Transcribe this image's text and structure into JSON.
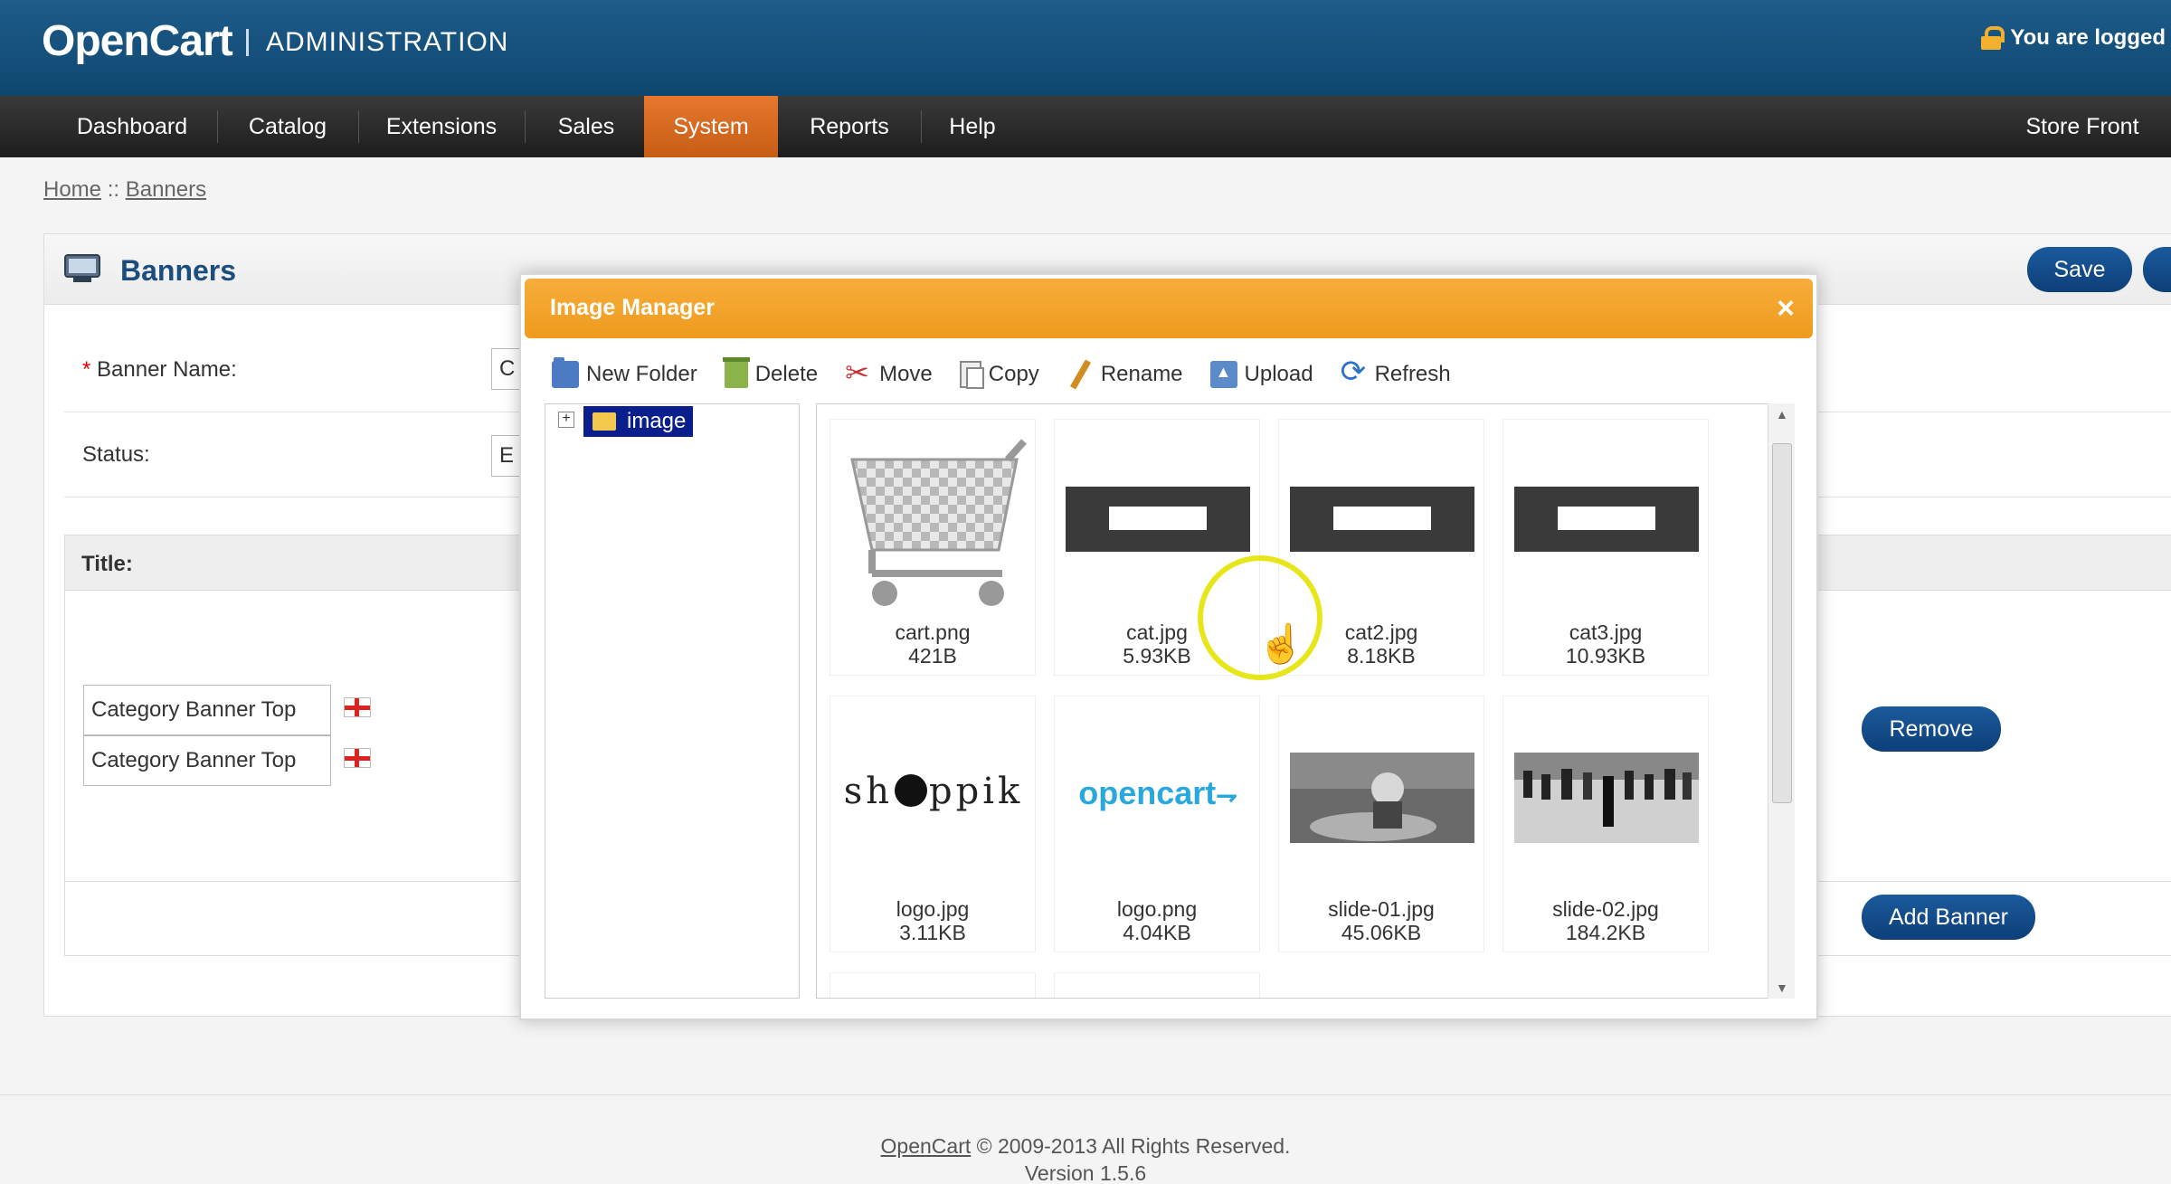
{
  "header": {
    "brand": "OpenCart",
    "section": "ADMINISTRATION",
    "user_status": "You are logged"
  },
  "menu": {
    "items": [
      {
        "label": "Dashboard"
      },
      {
        "label": "Catalog"
      },
      {
        "label": "Extensions"
      },
      {
        "label": "Sales"
      },
      {
        "label": "System",
        "active": true
      },
      {
        "label": "Reports"
      },
      {
        "label": "Help"
      }
    ],
    "store_front": "Store Front"
  },
  "breadcrumb": {
    "home": "Home",
    "separator": "::",
    "current": "Banners"
  },
  "page": {
    "title": "Banners",
    "save_label": "Save",
    "banner_name_label": "Banner Name:",
    "banner_name_value": "C",
    "status_label": "Status:",
    "status_value": "E",
    "title_column": "Title:",
    "title_rows": [
      "Category Banner Top",
      "Category Banner Top"
    ],
    "remove_label": "Remove",
    "add_banner_label": "Add Banner",
    "icon": "banner-screen-icon"
  },
  "image_manager": {
    "title": "Image Manager",
    "close": "×",
    "toolbar": {
      "new_folder": "New Folder",
      "delete": "Delete",
      "move": "Move",
      "copy": "Copy",
      "rename": "Rename",
      "upload": "Upload",
      "refresh": "Refresh"
    },
    "tree": {
      "expand": "+",
      "root": "image"
    },
    "files": [
      {
        "name": "cart.png",
        "size": "421B"
      },
      {
        "name": "cat.jpg",
        "size": "5.93KB"
      },
      {
        "name": "cat2.jpg",
        "size": "8.18KB"
      },
      {
        "name": "cat3.jpg",
        "size": "10.93KB"
      },
      {
        "name": "logo.jpg",
        "size": "3.11KB"
      },
      {
        "name": "logo.png",
        "size": "4.04KB"
      },
      {
        "name": "slide-01.jpg",
        "size": "45.06KB"
      },
      {
        "name": "slide-02.jpg",
        "size": "184.2KB"
      }
    ],
    "thumb_text": {
      "shoppik_left": "sh",
      "shoppik_right": "ppik",
      "opencart_logo": "opencart"
    }
  },
  "footer": {
    "link": "OpenCart",
    "copyright": "© 2009-2013 All Rights Reserved.",
    "version": "Version 1.5.6"
  },
  "colors": {
    "header_blue": "#1e5c8a",
    "menu_active": "#e6772e",
    "modal_title": "#f7ad3a",
    "button_blue": "#1b5a9c",
    "tree_selected": "#0a1e8c"
  }
}
